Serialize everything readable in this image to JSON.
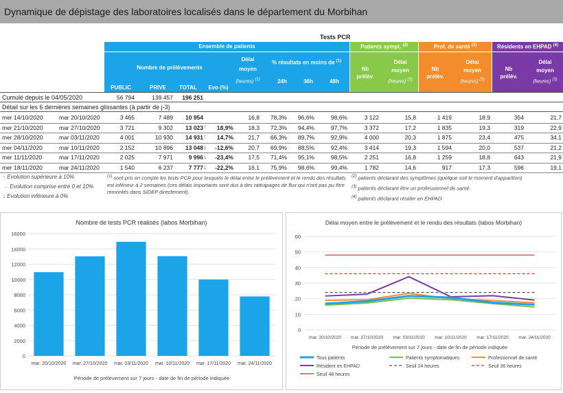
{
  "title": "Dynamique de dépistage des laboratoires localisés dans le département du Morbihan",
  "table": {
    "supertitle": "Tests PCR",
    "groups": {
      "ensemble": "Ensemble de patients",
      "sympt": "Patients sympt.",
      "sympt_sup": "(2)",
      "prof": "Prof. de santé",
      "prof_sup": "(3)",
      "ehpad": "Résidents en EHPAD",
      "ehpad_sup": "(4)"
    },
    "headers": {
      "nb_prelev": "Nombre de prélèvements",
      "delai_moyen_l1": "Délai",
      "delai_moyen_l2": "moyen",
      "delai_unit": "(heures)",
      "sup1": "(1)",
      "pct": "% résultats en moins de",
      "h24": "24h",
      "h36": "36h",
      "h48": "48h",
      "nb": "Nb",
      "prelev": "prélèv.",
      "public": "PUBLIC",
      "prive": "PRIVE",
      "total": "TOTAL",
      "evo": "Evo (%)"
    },
    "cumul": {
      "label": "Cumulé depuis le 04/05/2020",
      "public": "56 794",
      "prive": "139 457",
      "total": "196 251"
    },
    "detail_label": "Détail sur les 6 dernières semaines glissantes (à partir de j-3)",
    "rows": [
      {
        "d1": "mer 14/10/2020",
        "d2": "mar 20/10/2020",
        "pub": "3 465",
        "pri": "7 489",
        "tot": "10 954",
        "evo": "",
        "arrow": "",
        "del": "16,8",
        "p24": "78,3%",
        "p36": "96,6%",
        "p48": "98,6%",
        "snb": "3 122",
        "sdel": "15,8",
        "pnb": "1 419",
        "pdel": "18,9",
        "enb": "354",
        "edel": "21,7"
      },
      {
        "d1": "mer 21/10/2020",
        "d2": "mar 27/10/2020",
        "pub": "3 721",
        "pri": "9 302",
        "tot": "13 023",
        "evo": "18,9%",
        "arrow": "up",
        "del": "18,3",
        "p24": "72,3%",
        "p36": "94,4%",
        "p48": "97,7%",
        "snb": "3 372",
        "sdel": "17,2",
        "pnb": "1 835",
        "pdel": "19,3",
        "enb": "319",
        "edel": "22,9"
      },
      {
        "d1": "mer 28/10/2020",
        "d2": "mar 03/11/2020",
        "pub": "4 001",
        "pri": "10 930",
        "tot": "14 931",
        "evo": "14,7%",
        "arrow": "up",
        "del": "21,7",
        "p24": "66,3%",
        "p36": "89,7%",
        "p48": "92,9%",
        "snb": "4 000",
        "sdel": "20,3",
        "pnb": "1 875",
        "pdel": "23,4",
        "enb": "475",
        "edel": "34,1"
      },
      {
        "d1": "mer 04/11/2020",
        "d2": "mar 10/11/2020",
        "pub": "2 152",
        "pri": "10 896",
        "tot": "13 048",
        "evo": "-12,6%",
        "arrow": "down",
        "del": "20,7",
        "p24": "69,9%",
        "p36": "88,5%",
        "p48": "92,4%",
        "snb": "3 414",
        "sdel": "19,3",
        "pnb": "1 594",
        "pdel": "20,0",
        "enb": "537",
        "edel": "21,2"
      },
      {
        "d1": "mer 11/11/2020",
        "d2": "mar 17/11/2020",
        "pub": "2 025",
        "pri": "7 971",
        "tot": "9 996",
        "evo": "-23,4%",
        "arrow": "down",
        "del": "17,5",
        "p24": "71,4%",
        "p36": "95,1%",
        "p48": "98,5%",
        "snb": "2 251",
        "sdel": "16,8",
        "pnb": "1 259",
        "pdel": "18,8",
        "enb": "643",
        "edel": "21,9"
      },
      {
        "d1": "mer 18/11/2020",
        "d2": "mar 24/11/2020",
        "pub": "1 540",
        "pri": "6 237",
        "tot": "7 777",
        "evo": "-22,2%",
        "arrow": "down",
        "del": "16,1",
        "p24": "75,9%",
        "p36": "98,6%",
        "p48": "99,4%",
        "snb": "1 782",
        "sdel": "14,6",
        "pnb": "917",
        "pdel": "17,3",
        "enb": "596",
        "edel": "19,1"
      }
    ]
  },
  "legend": {
    "up": "Evolution supérieure à 10%",
    "mid": "Evolution comprise entre 0 et 10%",
    "down": "Evolution inférieure à 0%",
    "colors": {
      "up": "#5aa469",
      "mid": "#f0a030",
      "down": "#c0392b"
    }
  },
  "notes": {
    "n1_mark": "(1)",
    "n1": "sont pris en compte les tests PCR pour lesquels le délai entre le prélèvement et le rendu des résultats est inférieur à 2 semaines (ces délais importants sont dus à des rattrapages de flux qui n'ont pas pu être remontés dans SIDEP directement).",
    "n2_mark": "(2)",
    "n2": "patients déclarant des symptômes (quelque soit le moment d'apparition)",
    "n3_mark": "(3)",
    "n3": "patients déclarant être un professionnel de santé",
    "n4_mark": "(4)",
    "n4": "patients déclarant résider en EHPAD"
  },
  "chart_data": [
    {
      "type": "bar",
      "title": "Nombre de tests PCR réalisés (labos Morbihan)",
      "xlabel": "Période de prélèvement sur 7 jours - date de fin de période indiquée",
      "ylabel": "",
      "categories": [
        "mar. 20/10/2020",
        "mar. 27/10/2020",
        "mar. 03/11/2020",
        "mar. 10/11/2020",
        "mar. 17/11/2020",
        "mar. 24/11/2020"
      ],
      "values": [
        10954,
        13023,
        14931,
        13048,
        9996,
        7777
      ],
      "ylim": [
        0,
        16000
      ],
      "yticks": [
        "0",
        "2000",
        "4000",
        "6000",
        "8000",
        "10000",
        "12000",
        "14000",
        "16000"
      ],
      "color": "#1ba4e8",
      "grid": true
    },
    {
      "type": "line",
      "title": "Délai moyen entre le prélèvement et le rendu des résultats (labos Morbihan)",
      "xlabel": "Période de prélèvement sur 7 jours - date de fin de période indiquée",
      "ylabel": "",
      "categories": [
        "mar. 20/10/2020",
        "mar. 27/10/2020",
        "mar. 03/11/2020",
        "mar. 10/11/2020",
        "mar. 17/11/2020",
        "mar. 24/11/2020"
      ],
      "ylim": [
        0,
        60
      ],
      "yticks": [
        "0",
        "10",
        "20",
        "30",
        "40",
        "50",
        "60"
      ],
      "grid": true,
      "legend_position": "bottom",
      "series": [
        {
          "name": "Tous patients",
          "values": [
            16.8,
            18.3,
            21.7,
            20.7,
            17.5,
            16.1
          ],
          "color": "#1ba4e8",
          "dash": "",
          "width": 3
        },
        {
          "name": "Patients symptomatiques",
          "values": [
            15.8,
            17.2,
            20.3,
            19.3,
            16.8,
            14.6
          ],
          "color": "#7ac043",
          "dash": "",
          "width": 2
        },
        {
          "name": "Professionnel de santé",
          "values": [
            18.9,
            19.3,
            23.4,
            20.0,
            18.8,
            17.3
          ],
          "color": "#f28c2c",
          "dash": "",
          "width": 2
        },
        {
          "name": "Résident en EHPAD",
          "values": [
            21.7,
            22.9,
            34.1,
            21.2,
            21.9,
            19.1
          ],
          "color": "#7a3aa6",
          "dash": "",
          "width": 2
        },
        {
          "name": "Seuil 24 heures",
          "values": [
            24,
            24,
            24,
            24,
            24,
            24
          ],
          "color": "#555555",
          "dash": "4,3",
          "width": 1.2
        },
        {
          "name": "Seuil 36 heures",
          "values": [
            36,
            36,
            36,
            36,
            36,
            36
          ],
          "color": "#e03030",
          "dash": "4,3",
          "width": 1.2
        },
        {
          "name": "Seuil 48 heures",
          "values": [
            48,
            48,
            48,
            48,
            48,
            48
          ],
          "color": "#c0302a",
          "dash": "",
          "width": 1.2
        }
      ]
    }
  ]
}
